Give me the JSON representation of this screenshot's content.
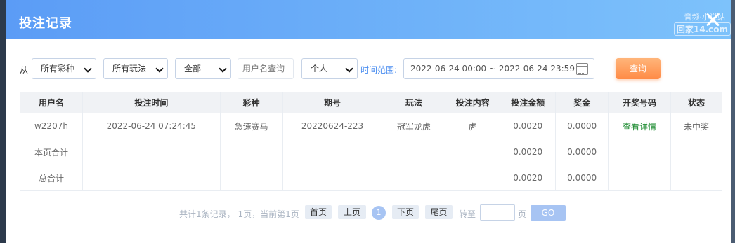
{
  "modal": {
    "title": "投注记录",
    "watermark_top": "音频·小说站",
    "watermark_bottom": "回家14.com"
  },
  "filters": {
    "from_label": "从",
    "lottery_select": "所有彩种",
    "play_select": "所有玩法",
    "status_select": "全部",
    "username_placeholder": "用户名查询",
    "scope_select": "个人",
    "range_label": "时间范围:",
    "date_range": "2022-06-24 00:00 ~ 2022-06-24 23:59",
    "query_button": "查询"
  },
  "table": {
    "headers": [
      "用户名",
      "投注时间",
      "彩种",
      "期号",
      "玩法",
      "投注内容",
      "投注金额",
      "奖金",
      "开奖号码",
      "状态"
    ],
    "row": {
      "username": "w2207h",
      "bet_time": "2022-06-24 07:24:45",
      "lottery": "急速赛马",
      "issue": "20220624-223",
      "play": "冠军龙虎",
      "content": "虎",
      "amount": "0.0020",
      "prize": "0.0000",
      "draw_link": "查看详情",
      "status": "未中奖"
    },
    "page_total": {
      "label": "本页合计",
      "amount": "0.0020",
      "prize": "0.0000"
    },
    "grand_total": {
      "label": "总合计",
      "amount": "0.0020",
      "prize": "0.0000"
    }
  },
  "pager": {
    "info": "共计1条记录， 1页，当前第1页",
    "first": "首页",
    "prev": "上页",
    "current": "1",
    "next": "下页",
    "last": "尾页",
    "goto_label": "转至",
    "page_label": "页",
    "go": "GO"
  }
}
